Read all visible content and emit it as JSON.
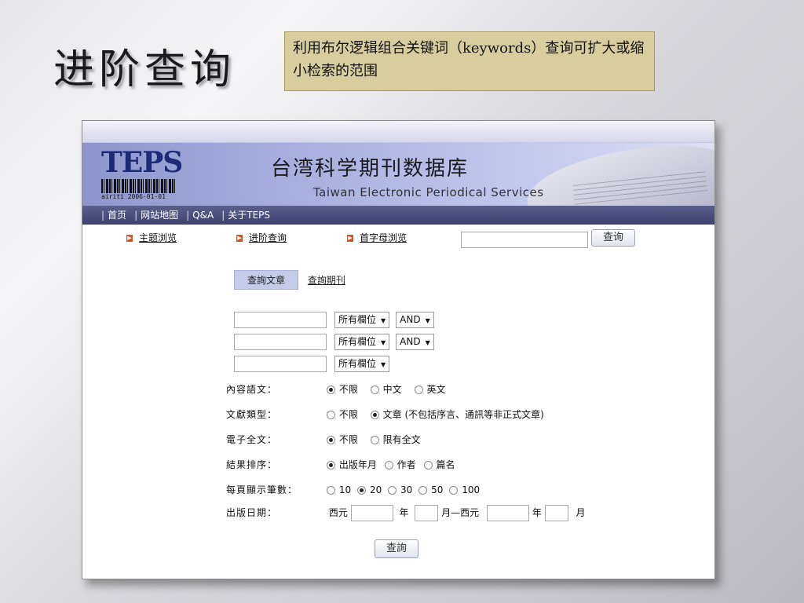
{
  "slide": {
    "title": "进阶查询",
    "note": "利用布尔逻辑组合关键词（keywords）查询可扩大或缩小检索的范围"
  },
  "site": {
    "logo_text": "TEPS",
    "logo_sub": "airiti 2006-01-01",
    "title_cn": "台湾科学期刊数据库",
    "title_en": "Taiwan Electronic Periodical Services",
    "nav": [
      "首页",
      "网站地图",
      "Q&A",
      "关于TEPS"
    ],
    "modes": [
      "主题浏览",
      "进阶查询",
      "首字母浏览"
    ],
    "search_button": "查询"
  },
  "form": {
    "tab_active": "查詢文章",
    "tab_other": "查詢期刊",
    "field_select": "所有欄位",
    "bool_select": "AND",
    "rows": [
      {
        "label": "內容語文：",
        "options": [
          {
            "text": "不限",
            "on": true
          },
          {
            "text": "中文",
            "on": false
          },
          {
            "text": "英文",
            "on": false
          }
        ]
      },
      {
        "label": "文獻類型：",
        "options": [
          {
            "text": "不限",
            "on": false
          },
          {
            "text": "文章 (不包括序言、通訊等非正式文章)",
            "on": true
          }
        ]
      },
      {
        "label": "電子全文：",
        "options": [
          {
            "text": "不限",
            "on": true
          },
          {
            "text": "限有全文",
            "on": false
          }
        ]
      },
      {
        "label": "結果排序：",
        "options": [
          {
            "text": "出版年月",
            "on": true
          },
          {
            "text": "作者",
            "on": false
          },
          {
            "text": "篇名",
            "on": false
          }
        ]
      },
      {
        "label": "每頁顯示筆數：",
        "options": [
          {
            "text": "10",
            "on": false
          },
          {
            "text": "20",
            "on": true
          },
          {
            "text": "30",
            "on": false
          },
          {
            "text": "50",
            "on": false
          },
          {
            "text": "100",
            "on": false
          }
        ]
      }
    ],
    "date_label": "出版日期：",
    "date_xiyuan1": "西元",
    "date_nian1": "年",
    "date_yue_xiyuan": "月—西元",
    "date_nian2": "年",
    "date_yue2": "月",
    "submit": "查詢"
  }
}
